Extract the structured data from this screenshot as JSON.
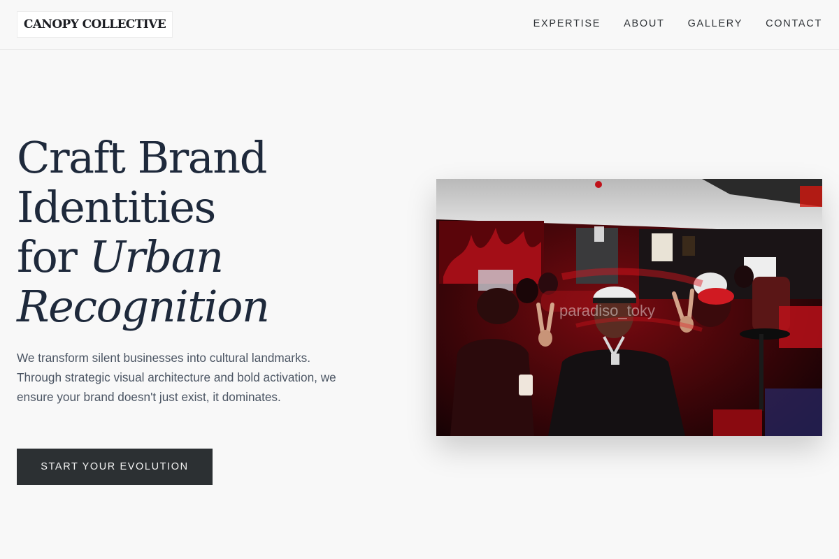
{
  "brand": {
    "name": "CANOPY COLLECTIVE"
  },
  "nav": {
    "items": [
      {
        "label": "EXPERTISE"
      },
      {
        "label": "ABOUT"
      },
      {
        "label": "GALLERY"
      },
      {
        "label": "CONTACT"
      }
    ]
  },
  "hero": {
    "title_line1": "Craft Brand",
    "title_line2": "Identities",
    "title_line3_prefix": "for ",
    "title_line3_emphasis": "Urban",
    "title_line4": "Recognition",
    "description": "We transform silent businesses into cultural landmarks. Through strategic visual architecture and bold activation, we ensure your brand doesn't just exist, it dominates.",
    "cta_label": "START YOUR EVOLUTION"
  },
  "photo": {
    "watermark": "paradiso_toky",
    "accent_color": "#c0121a"
  }
}
